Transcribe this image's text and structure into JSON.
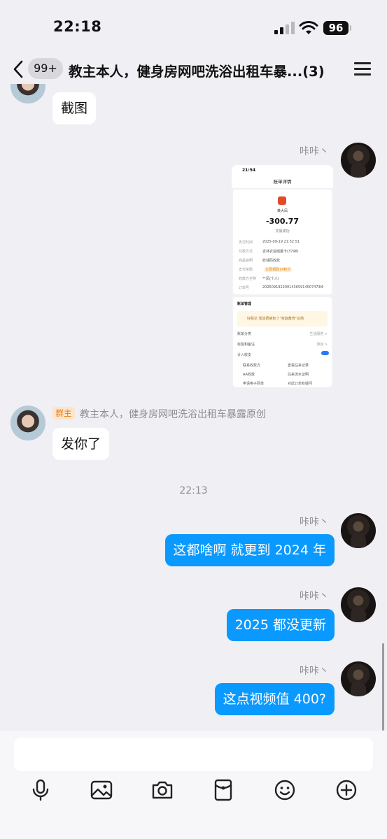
{
  "status_bar": {
    "time": "22:18",
    "battery": "96"
  },
  "header": {
    "unread_count": "99+",
    "title": "教主本人，健身房网吧洗浴出租车暴...(3)"
  },
  "messages": [
    {
      "kind": "text",
      "side": "incoming",
      "text": "截图"
    },
    {
      "kind": "image",
      "side": "outgoing",
      "sender": "咔咔丶",
      "screenshot": {
        "time": "21:54",
        "nav_title": "账单详情",
        "merchant": "黄大凤",
        "amount": "-300.77",
        "status": "交易成功",
        "rows": [
          {
            "label": "支付时间",
            "value": "2025-09-19 21:52:51"
          },
          {
            "label": "付款方式",
            "value": "吉林农信储蓄卡(3798)"
          },
          {
            "label": "商品说明",
            "value": "收钱码收款"
          },
          {
            "label": "支付奖励",
            "value": "立即领取14积分"
          },
          {
            "label": "收款方全称",
            "value": "**凤(个人)"
          },
          {
            "label": "订单号",
            "value": "20250919220014365914007473l6"
          }
        ],
        "section_title": "账单管理",
        "promo": "好股达 笔消费被标了\"家庭教育\"总结",
        "manage_rows": [
          {
            "label": "账单分类",
            "value": "生活服务 >"
          },
          {
            "label": "标签和备注",
            "value": "添加 >"
          },
          {
            "label": "计入收支",
            "value": ""
          }
        ],
        "links": [
          "联系收款方",
          "查看往来记录",
          "AA收款",
          "往来流水证明",
          "申请电子回单",
          "对此订单有疑问"
        ]
      }
    },
    {
      "kind": "text",
      "side": "incoming",
      "sender": "教主本人，健身房网吧洗浴出租车暴露原创",
      "badge": "群主",
      "text": "发你了"
    },
    {
      "kind": "divider",
      "text": "22:13"
    },
    {
      "kind": "text",
      "side": "outgoing",
      "sender": "咔咔丶",
      "text": "这都啥啊 就更到 2024 年"
    },
    {
      "kind": "text",
      "side": "outgoing",
      "sender": "咔咔丶",
      "text": "2025 都没更新"
    },
    {
      "kind": "text",
      "side": "outgoing",
      "sender": "咔咔丶",
      "text": "这点视频值 400?"
    }
  ],
  "toolbar": {
    "icons": [
      "microphone-icon",
      "image-icon",
      "camera-icon",
      "red-packet-icon",
      "emoji-icon",
      "plus-icon"
    ]
  },
  "colors": {
    "outgoing_bubble": "#0a99ff",
    "incoming_bubble": "#ffffff",
    "background": "#efeff4",
    "owner_badge": "#e07b1a"
  }
}
